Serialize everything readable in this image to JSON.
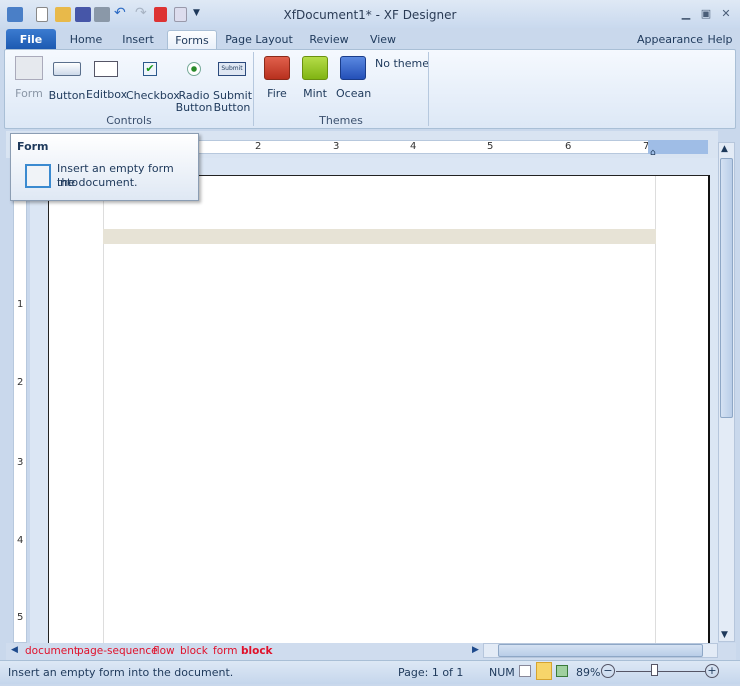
{
  "window": {
    "title": "XfDocument1* -  XF Designer"
  },
  "quick_access": [
    "app-icon",
    "new-icon",
    "open-icon",
    "save-icon",
    "print-icon",
    "undo-icon",
    "redo-icon",
    "pdf-icon",
    "preview-icon",
    "customize-icon"
  ],
  "tabs": [
    {
      "label": "File"
    },
    {
      "label": "Home"
    },
    {
      "label": "Insert"
    },
    {
      "label": "Forms"
    },
    {
      "label": "Page Layout"
    },
    {
      "label": "Review"
    },
    {
      "label": "View"
    }
  ],
  "active_tab": "Forms",
  "right_menu": {
    "appearance": "Appearance",
    "help": "Help"
  },
  "ribbon": {
    "controls": {
      "label": "Controls",
      "items": [
        {
          "label": "Form"
        },
        {
          "label": "Button"
        },
        {
          "label": "Editbox"
        },
        {
          "label": "Checkbox"
        },
        {
          "label": "Radio\nButton",
          "l1": "Radio",
          "l2": "Button"
        },
        {
          "label": "Submit\nButton",
          "l1": "Submit",
          "l2": "Button"
        }
      ]
    },
    "themes": {
      "label": "Themes",
      "items": [
        {
          "label": "Fire",
          "color": "#c8402e"
        },
        {
          "label": "Mint",
          "color": "#8fc21e"
        },
        {
          "label": "Ocean",
          "color": "#2d5ec6"
        }
      ],
      "none": "No theme"
    }
  },
  "ruler": {
    "h": [
      "2",
      "3",
      "4",
      "5",
      "6",
      "7"
    ],
    "v": [
      "1",
      "2",
      "3",
      "4",
      "5"
    ]
  },
  "tooltip": {
    "title": "Form",
    "text1": "Insert an empty form into",
    "text2": "the document."
  },
  "breadcrumbs": [
    "document",
    "page-sequence",
    "flow",
    "block",
    "form",
    "block"
  ],
  "status": {
    "message": "Insert an empty form into the document.",
    "page": "Page: 1 of 1",
    "num": "NUM",
    "zoom": "89%"
  }
}
